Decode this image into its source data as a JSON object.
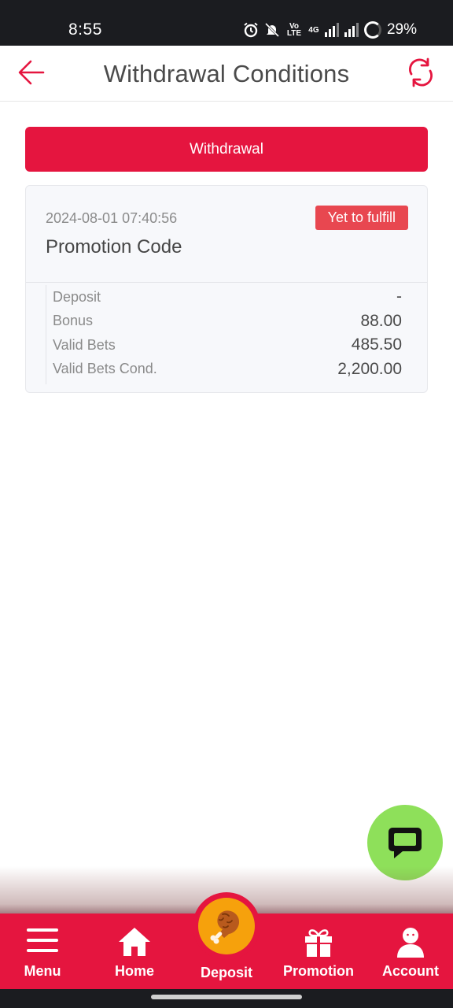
{
  "status_bar": {
    "time": "8:55",
    "network_label": "Vo LTE",
    "data_label": "4G",
    "battery": "29%"
  },
  "header": {
    "title": "Withdrawal Conditions",
    "accent_color": "#e5153f"
  },
  "withdrawal_button": {
    "label": "Withdrawal"
  },
  "condition_card": {
    "date": "2024-08-01 07:40:56",
    "status": "Yet to fulfill",
    "code": "Promotion Code",
    "rows": [
      {
        "label": "Deposit",
        "value": "-"
      },
      {
        "label": "Bonus",
        "value": "88.00"
      },
      {
        "label": "Valid Bets",
        "value": "485.50"
      },
      {
        "label": "Valid Bets Cond.",
        "value": "2,200.00"
      }
    ]
  },
  "chat_fab": {
    "icon": "chat-bubble-icon",
    "color": "#8ee05a"
  },
  "tab_bar": {
    "items": [
      {
        "label": "Menu",
        "icon": "menu-icon"
      },
      {
        "label": "Home",
        "icon": "home-icon"
      },
      {
        "label": "Deposit",
        "icon": "fried-chicken-icon"
      },
      {
        "label": "Promotion",
        "icon": "gift-icon"
      },
      {
        "label": "Account",
        "icon": "user-icon"
      }
    ]
  }
}
